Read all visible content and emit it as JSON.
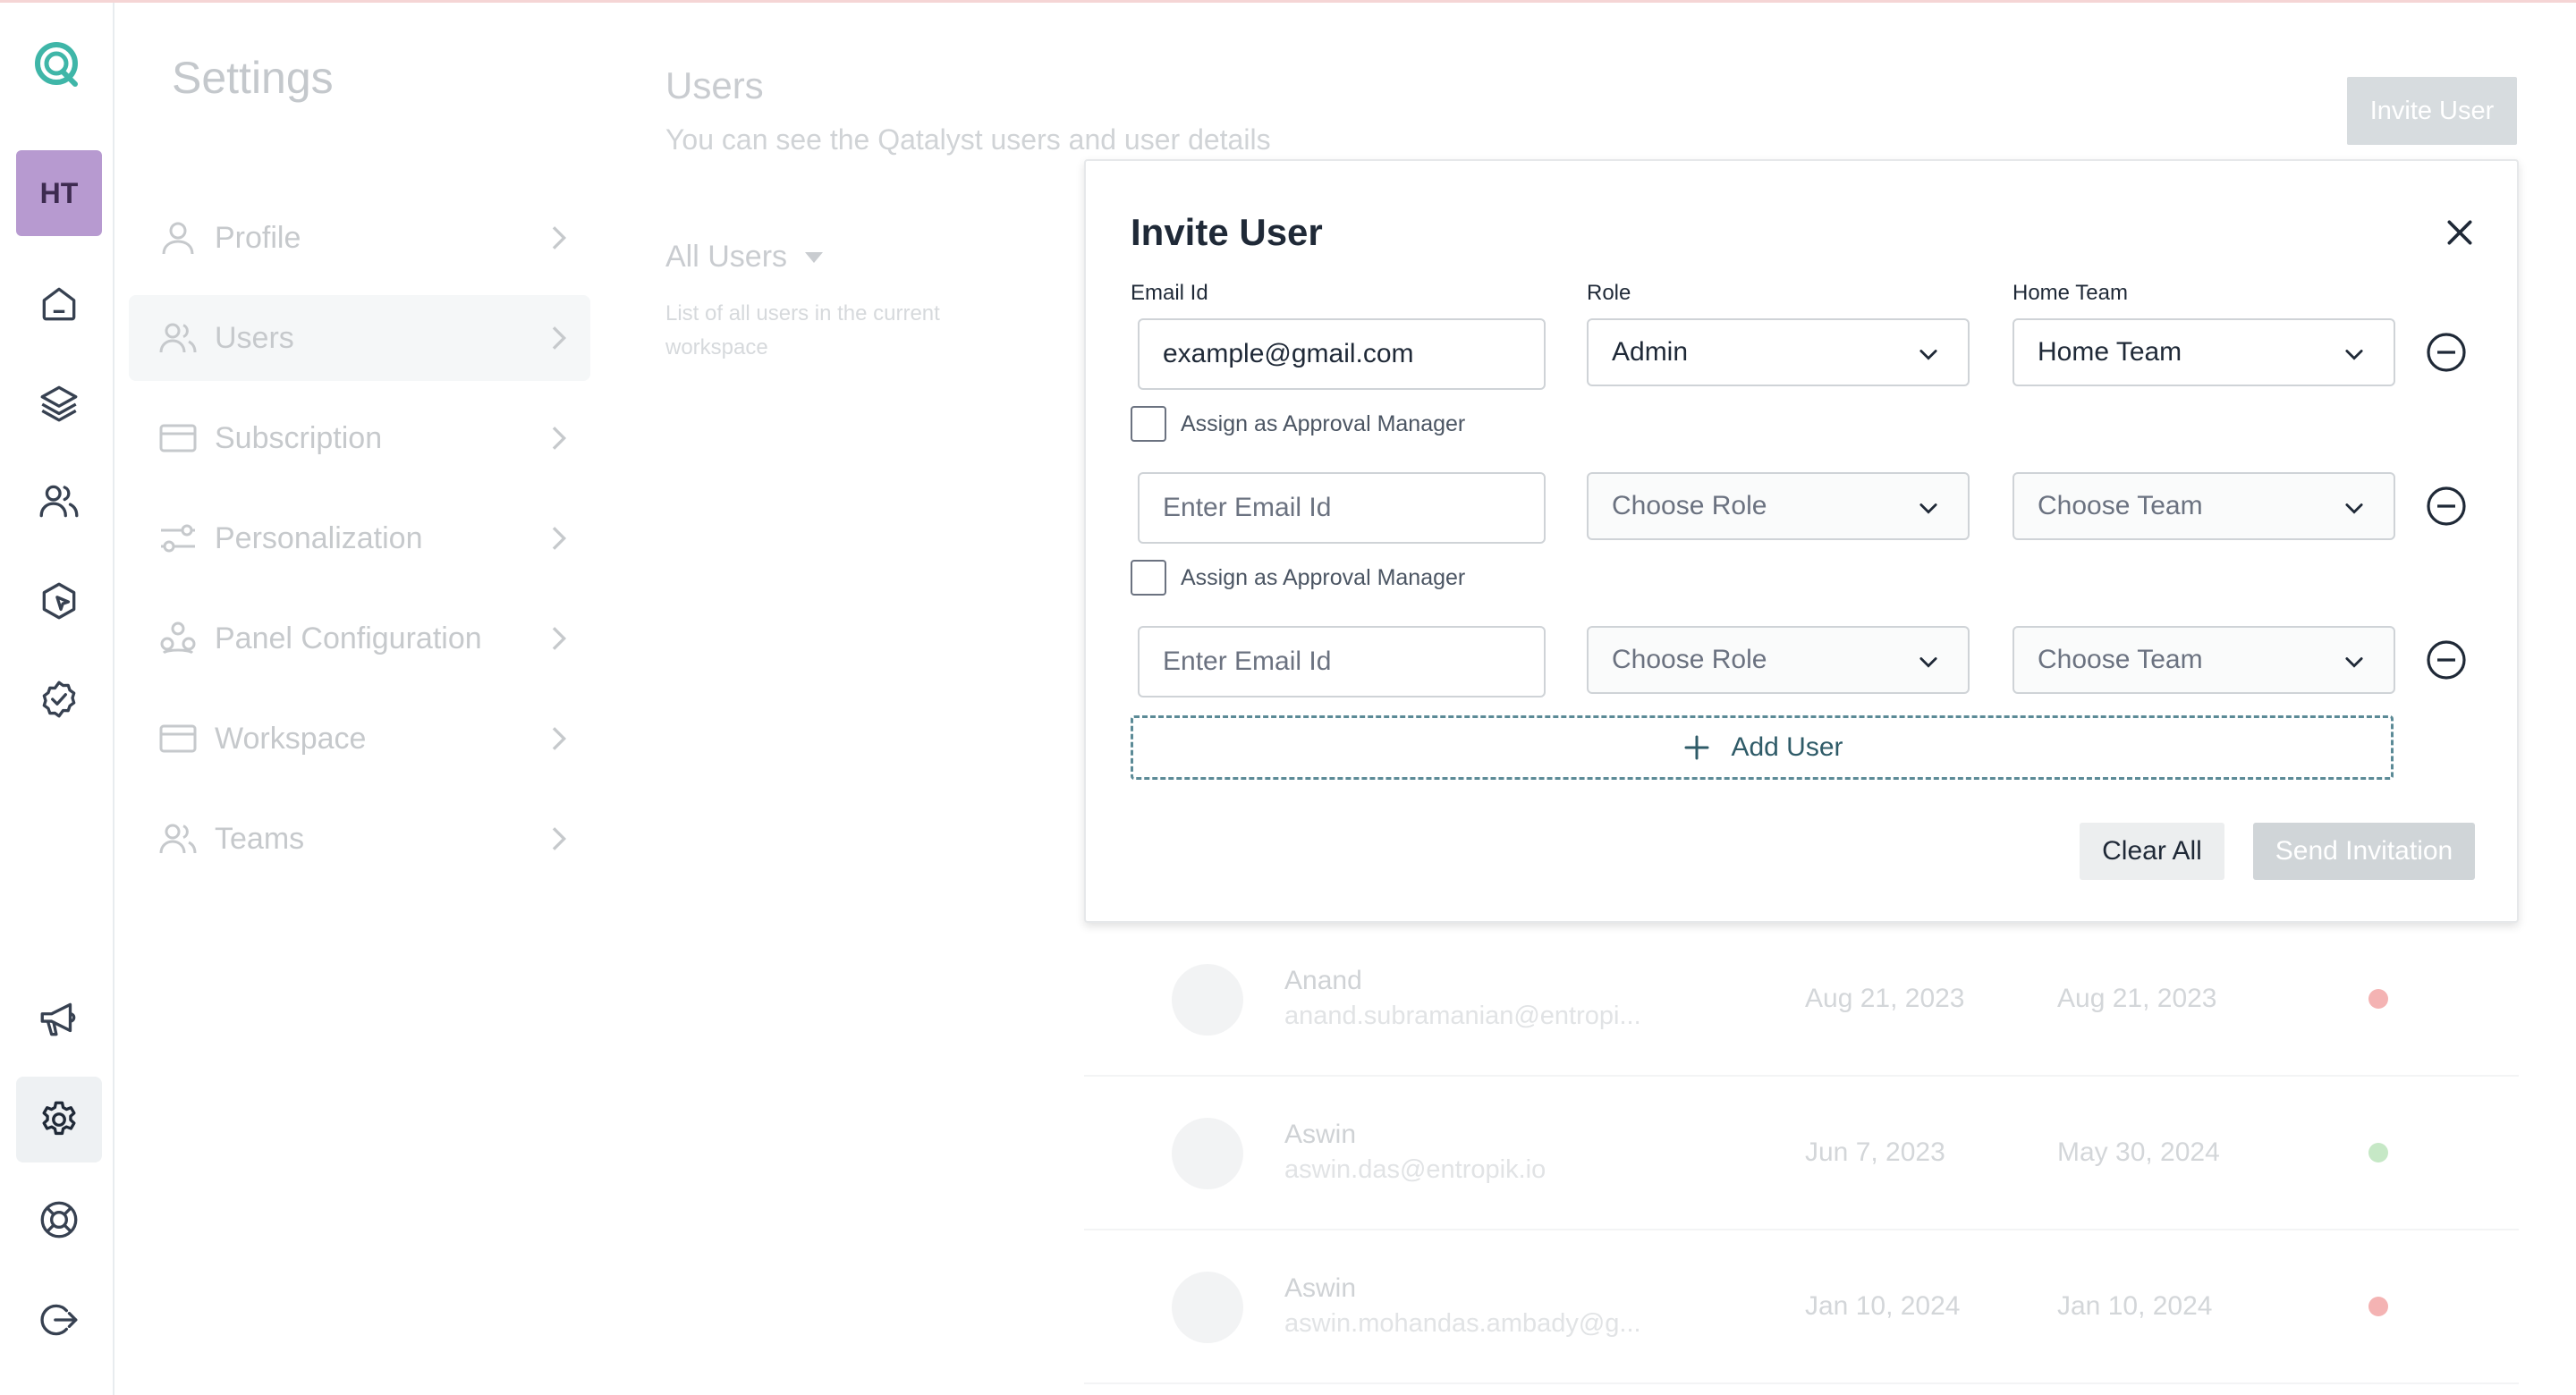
{
  "rail": {
    "avatar_initials": "HT",
    "items": [
      "home-icon",
      "layers-icon",
      "users-icon",
      "cursor-click-icon",
      "check-badge-icon",
      "megaphone-icon",
      "gear-icon",
      "lifebuoy-icon",
      "logout-icon"
    ],
    "active": "gear-icon"
  },
  "settings": {
    "title": "Settings",
    "nav": [
      {
        "label": "Profile",
        "icon": "user-icon"
      },
      {
        "label": "Users",
        "icon": "users-icon",
        "selected": true
      },
      {
        "label": "Subscription",
        "icon": "card-icon"
      },
      {
        "label": "Personalization",
        "icon": "sliders-icon"
      },
      {
        "label": "Panel Configuration",
        "icon": "panel-icon"
      },
      {
        "label": "Workspace",
        "icon": "card-icon"
      },
      {
        "label": "Teams",
        "icon": "users-icon"
      }
    ]
  },
  "users_page": {
    "title": "Users",
    "subtitle": "You can see the Qatalyst users and user details",
    "invite_button": "Invite User",
    "filter_label": "All Users",
    "list_description": "List of all users in the current workspace",
    "rows": [
      {
        "name": "Anand",
        "email": "anand.subramanian@entropi...",
        "date1": "Aug 21, 2023",
        "date2": "Aug 21, 2023",
        "status_color": "#f4b3b3"
      },
      {
        "name": "Aswin",
        "email": "aswin.das@entropik.io",
        "date1": "Jun 7, 2023",
        "date2": "May 30, 2024",
        "status_color": "#c6e8c6"
      },
      {
        "name": "Aswin",
        "email": "aswin.mohandas.ambady@g...",
        "date1": "Jan 10, 2024",
        "date2": "Jan 10, 2024",
        "status_color": "#f4b3b3"
      }
    ]
  },
  "modal": {
    "title": "Invite User",
    "labels": {
      "email": "Email Id",
      "role": "Role",
      "team": "Home Team"
    },
    "rows": [
      {
        "email_value": "example@gmail.com",
        "email_placeholder": "Enter Email Id",
        "role": "Admin",
        "team": "Home Team",
        "checkbox_label": "Assign as Approval Manager",
        "role_is_placeholder": false
      },
      {
        "email_value": "",
        "email_placeholder": "Enter Email Id",
        "role": "Choose Role",
        "team": "Choose Team",
        "checkbox_label": "Assign as Approval Manager",
        "role_is_placeholder": true
      },
      {
        "email_value": "",
        "email_placeholder": "Enter Email Id",
        "role": "Choose Role",
        "team": "Choose Team",
        "role_is_placeholder": true
      }
    ],
    "add_user_label": "Add User",
    "clear_label": "Clear All",
    "send_label": "Send Invitation"
  },
  "colors": {
    "accent": "#2f5b68",
    "logo": "#3fb6a8",
    "avatar_bg": "#b79ad0"
  }
}
